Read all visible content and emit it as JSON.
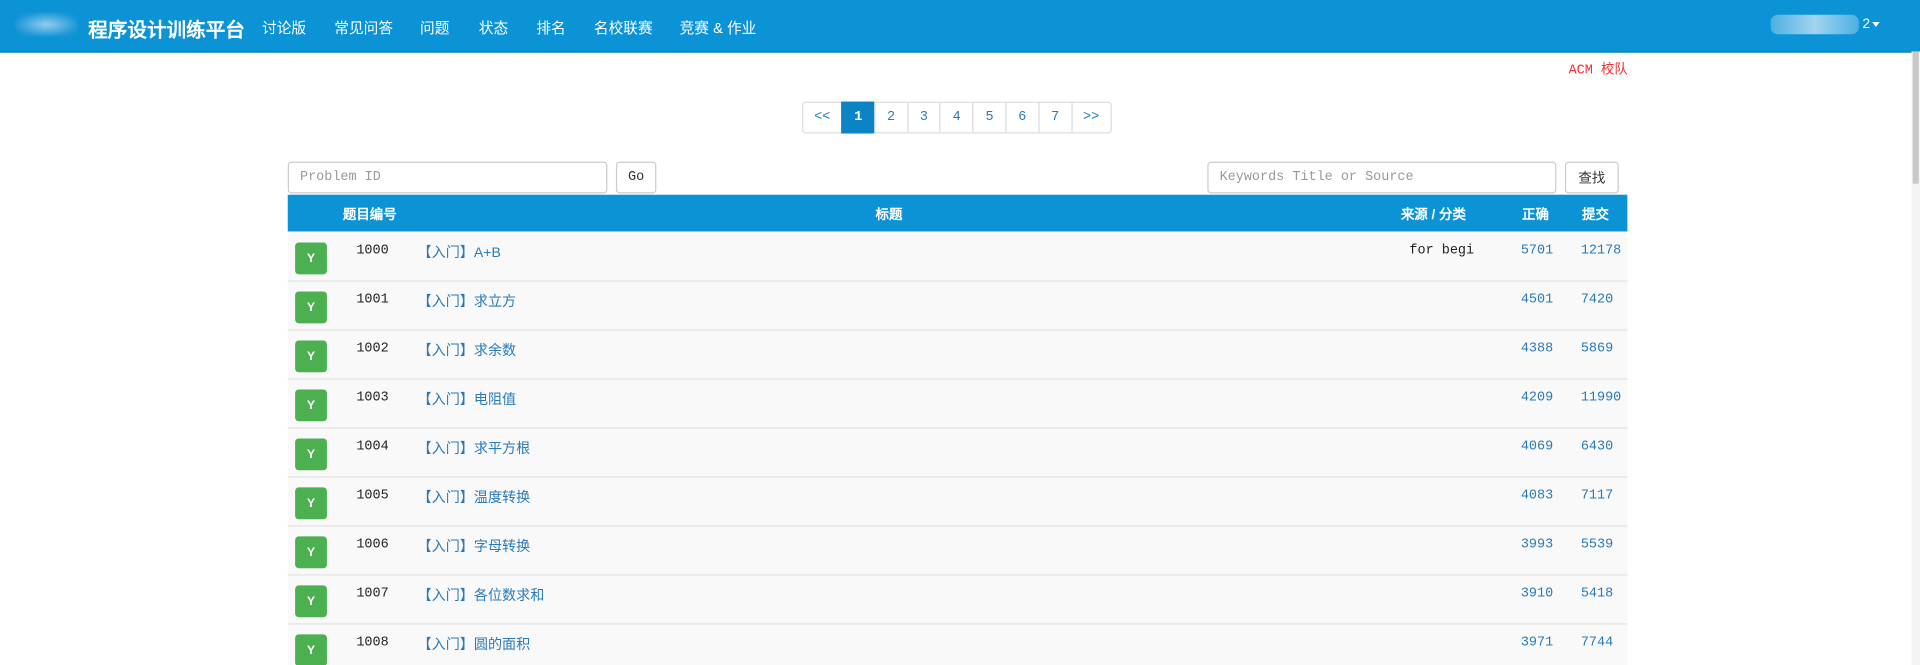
{
  "navbar": {
    "brand": "程序设计训练平台",
    "items": [
      "讨论版",
      "常见问答",
      "问题",
      "状态",
      "排名",
      "名校联赛",
      "竞赛 & 作业"
    ],
    "user_suffix": "2"
  },
  "acm_link": "ACM 校队",
  "pagination": {
    "prev": "<<",
    "pages": [
      "1",
      "2",
      "3",
      "4",
      "5",
      "6",
      "7"
    ],
    "next": ">>",
    "active": "1"
  },
  "search": {
    "id_placeholder": "Problem ID",
    "go_label": "Go",
    "keyword_placeholder": "Keywords Title or Source",
    "find_label": "查找"
  },
  "table": {
    "headers": {
      "id": "题目编号",
      "title": "标题",
      "source": "来源 / 分类",
      "accepted": "正确",
      "submitted": "提交"
    },
    "rows": [
      {
        "status": "Y",
        "id": "1000",
        "title": "【入门】A+B",
        "source": "for begi",
        "accepted": "5701",
        "submitted": "12178"
      },
      {
        "status": "Y",
        "id": "1001",
        "title": "【入门】求立方",
        "source": "",
        "accepted": "4501",
        "submitted": "7420"
      },
      {
        "status": "Y",
        "id": "1002",
        "title": "【入门】求余数",
        "source": "",
        "accepted": "4388",
        "submitted": "5869"
      },
      {
        "status": "Y",
        "id": "1003",
        "title": "【入门】电阻值",
        "source": "",
        "accepted": "4209",
        "submitted": "11990"
      },
      {
        "status": "Y",
        "id": "1004",
        "title": "【入门】求平方根",
        "source": "",
        "accepted": "4069",
        "submitted": "6430"
      },
      {
        "status": "Y",
        "id": "1005",
        "title": "【入门】温度转换",
        "source": "",
        "accepted": "4083",
        "submitted": "7117"
      },
      {
        "status": "Y",
        "id": "1006",
        "title": "【入门】字母转换",
        "source": "",
        "accepted": "3993",
        "submitted": "5539"
      },
      {
        "status": "Y",
        "id": "1007",
        "title": "【入门】各位数求和",
        "source": "",
        "accepted": "3910",
        "submitted": "5418"
      },
      {
        "status": "Y",
        "id": "1008",
        "title": "【入门】圆的面积",
        "source": "",
        "accepted": "3971",
        "submitted": "7744"
      }
    ]
  }
}
